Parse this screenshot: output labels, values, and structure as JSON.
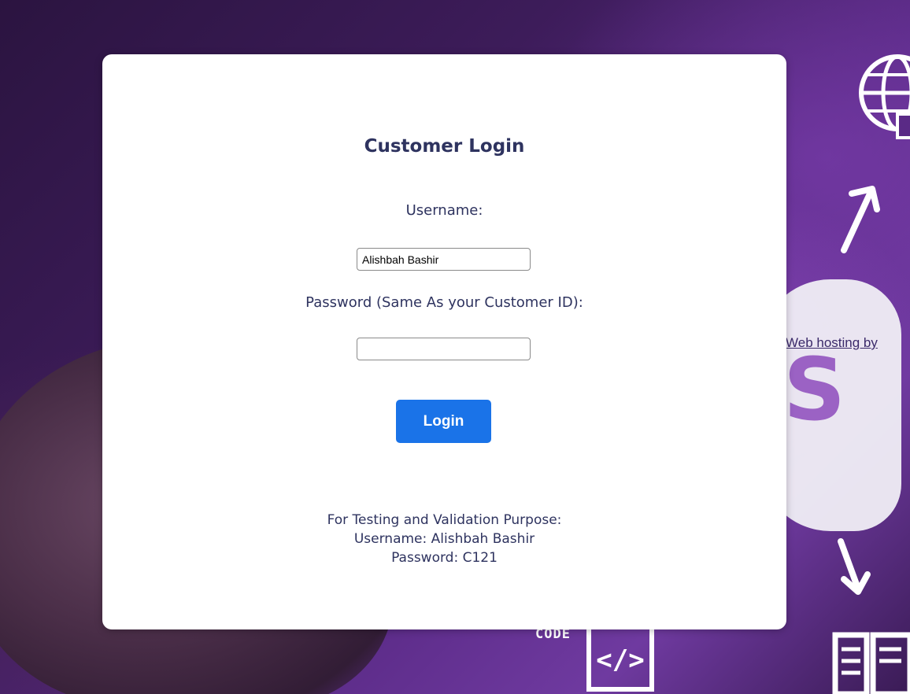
{
  "background": {
    "link_text": "Web hosting by",
    "code_label": "CODE",
    "code_icon": "</>",
    "cloud_letter": "S",
    "icons": [
      "globe-icon",
      "arrow-up-right-icon",
      "arrow-down-right-icon",
      "laptop-code-icon",
      "book-icon"
    ]
  },
  "login": {
    "title": "Customer Login",
    "username_label": "Username:",
    "username_value": "Alishbah Bashir",
    "password_label": "Password (Same As your Customer ID):",
    "password_value": "",
    "button_label": "Login"
  },
  "info": {
    "line1": "For Testing and Validation Purpose:",
    "line2": "Username: Alishbah Bashir",
    "line3": "Password: C121"
  },
  "colors": {
    "accent": "#1a73e8",
    "heading": "#2e335f",
    "background": "#4a2370"
  }
}
